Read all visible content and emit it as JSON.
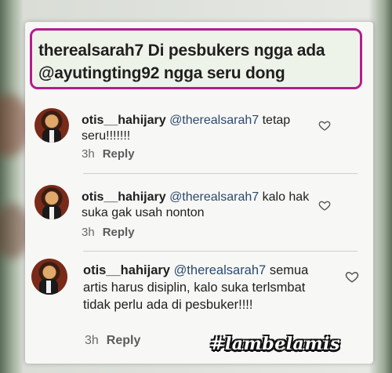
{
  "post": {
    "caption": "therealsarah7 Di pesbukers ngga ada @ayutingting92 ngga seru dong"
  },
  "comments": [
    {
      "username": "otis__hahijary",
      "mention": "@therealsarah7",
      "text": "tetap seru!!!!!!!",
      "time": "3h",
      "reply_label": "Reply"
    },
    {
      "username": "otis__hahijary",
      "mention": "@therealsarah7",
      "text": "kalo hak suka gak usah nonton",
      "time": "3h",
      "reply_label": "Reply"
    },
    {
      "username": "otis__hahijary",
      "mention": "@therealsarah7",
      "text": "semua artis harus disiplin, kalo suka terlsmbat tidak perlu ada di pesbuker!!!!",
      "time": "3h",
      "reply_label": "Reply"
    }
  ],
  "watermark": "#lambelamis",
  "colors": {
    "highlight_border": "#b21d8e",
    "mention": "#2b4a6e"
  },
  "icons": [
    "heart-icon"
  ]
}
